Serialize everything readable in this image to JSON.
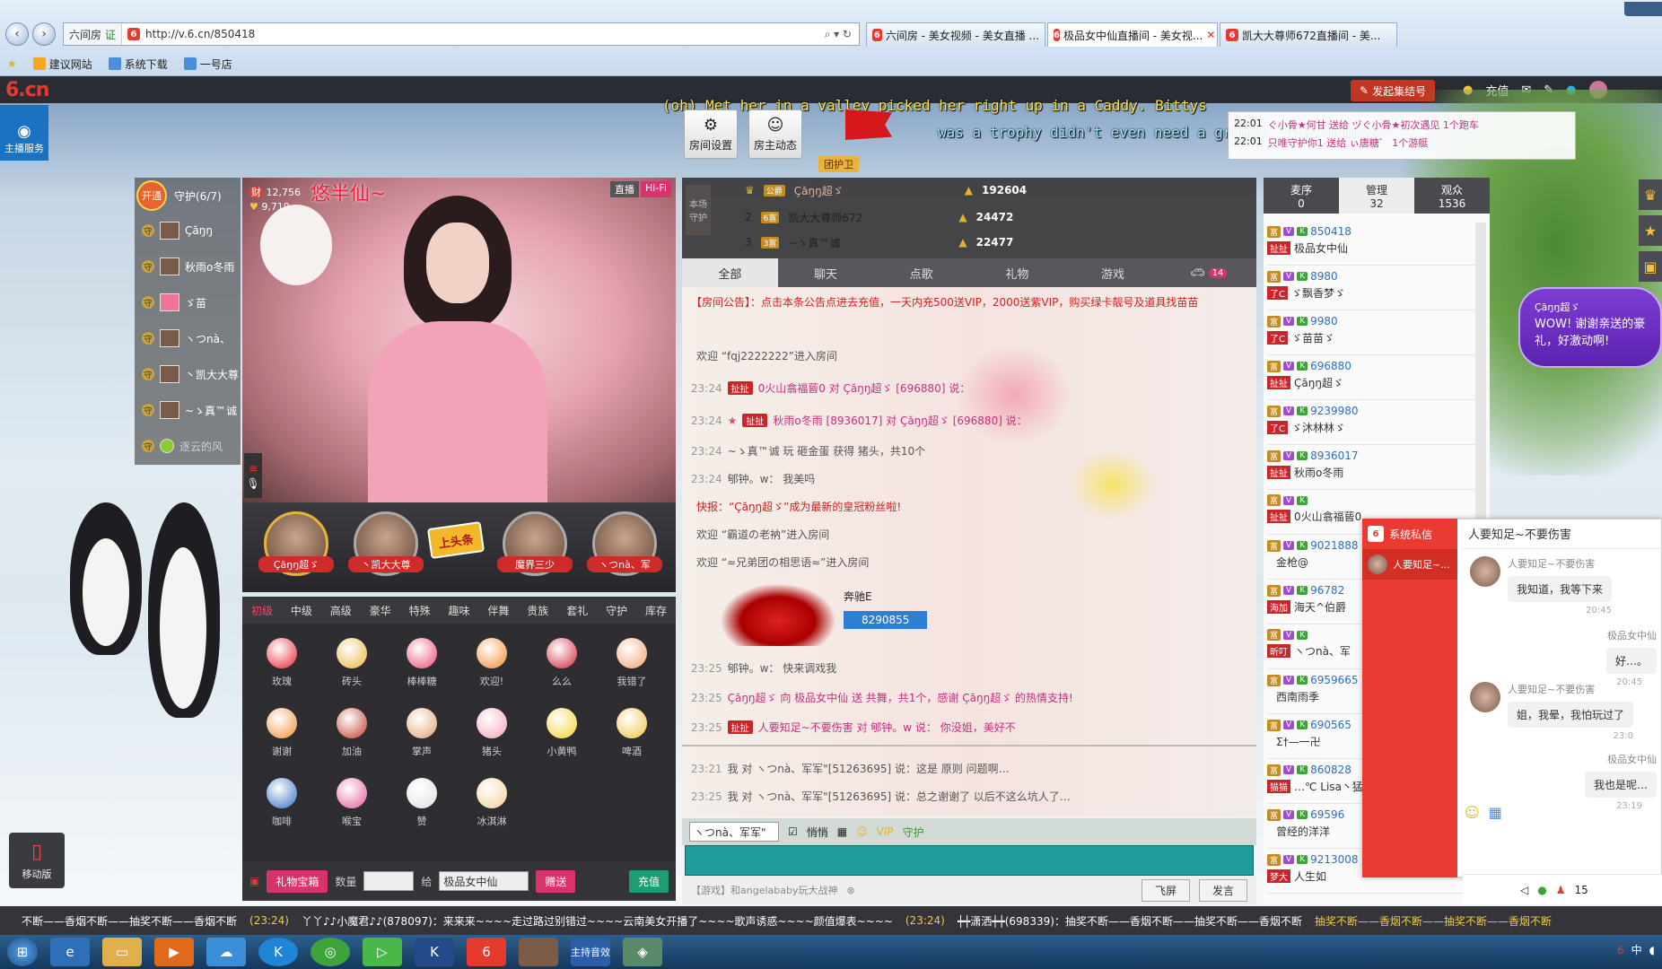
{
  "browser": {
    "site_tag": "六间房",
    "url": "http://v.6.cn/850418",
    "tabs": [
      "六间房 - 美女视频 - 美女直播 ...",
      "极品女中仙直播间 - 美女视...",
      "凯大大尊师672直播间 - 美..."
    ],
    "favorites": [
      "建议网站",
      "系统下载",
      "一号店"
    ]
  },
  "site": {
    "logo": "6.cn",
    "jihao_button": "发起集结号",
    "topnav": [
      "充值"
    ],
    "kefu": "主播服务",
    "mobile": "移动版"
  },
  "lyrics": {
    "line1": "(oh) Met her in a valley picked her right up in a Caddy. Bittys",
    "line2": "was a trophy didn't even need a grammy. This mommys"
  },
  "room": {
    "settings_button": "房间设置",
    "dynamics_button": "房主动态",
    "tuanhu": "团护卫",
    "notifications": [
      {
        "time": "22:01",
        "text": "ぐ小骨★何甘 送给 ヅぐ小骨★初次遇见 1个跑车"
      },
      {
        "time": "22:01",
        "text": "只唯守护你1 送给 ぃ唐糖゛ 1个游艇"
      }
    ]
  },
  "guard": {
    "open_label": "开通",
    "title": "守护(6/7)",
    "members": [
      "Çăŋŋ",
      "秋雨o冬雨",
      "ゞ苗",
      "ヽつnà、",
      "丶凯大大尊",
      "~ゝ真™诚",
      "逐云的风"
    ]
  },
  "video": {
    "name": "悠半仙~",
    "stat1": "12,756",
    "stat2": "9,719",
    "live_label": "直播",
    "hifi_label": "Hi-Fi"
  },
  "rank_strip": {
    "labels": [
      "Çăŋŋ超ゞ",
      "丶凯大大尊",
      "魔界三少",
      "ヽつnà、军"
    ],
    "headline": "上头条"
  },
  "gifts": {
    "tabs": [
      "初级",
      "中级",
      "高级",
      "豪华",
      "特殊",
      "趣味",
      "伴舞",
      "贵族",
      "套礼",
      "守护",
      "库存"
    ],
    "items": [
      {
        "name": "玫瑰",
        "color": "#e2232e"
      },
      {
        "name": "砖头",
        "color": "#e8b33a"
      },
      {
        "name": "棒棒糖",
        "color": "#e84a6c"
      },
      {
        "name": "欢迎!",
        "color": "#f28a28"
      },
      {
        "name": "么么",
        "color": "#d02038"
      },
      {
        "name": "我错了",
        "color": "#f0a06a"
      },
      {
        "name": "谢谢",
        "color": "#f38e3a"
      },
      {
        "name": "加油",
        "color": "#c03a2a"
      },
      {
        "name": "掌声",
        "color": "#e5a070"
      },
      {
        "name": "猪头",
        "color": "#f3a0b8"
      },
      {
        "name": "小黄鸭",
        "color": "#f6d12a"
      },
      {
        "name": "啤酒",
        "color": "#f0c040"
      },
      {
        "name": "咖啡",
        "color": "#2d6fc0"
      },
      {
        "name": "喉宝",
        "color": "#e25a9a"
      },
      {
        "name": "赞",
        "color": "#e0e0e0"
      },
      {
        "name": "冰淇淋",
        "color": "#f0d090"
      }
    ],
    "box_label": "礼物宝箱",
    "qty_label": "数量",
    "to_label": "给",
    "to_value": "极品女中仙",
    "send_label": "赠送",
    "recharge_label": "充值"
  },
  "ranking": {
    "label": "本场守护",
    "rows": [
      {
        "rank": "",
        "name": "Çăŋŋ超ゞ",
        "score": "192604"
      },
      {
        "rank": "2",
        "name": "凯大大尊师672",
        "score": "24472"
      },
      {
        "rank": "3",
        "name": "~ゝ真™诚",
        "score": "22477"
      }
    ]
  },
  "chat": {
    "tabs": [
      "全部",
      "聊天",
      "点歌",
      "礼物",
      "游戏"
    ],
    "car_count": "14",
    "announcement": "【房间公告】：点击本条公告点进去充值，一天内充500送VIP，2000送紫VIP，购买绿卡靓号及道具找苗苗",
    "lines": [
      {
        "time": "",
        "text": "欢迎 “fqj2222222”进入房间"
      },
      {
        "time": "23:24",
        "text": "0火山翕福蒈0 对 Çăŋŋ超ゞ [696880] 说："
      },
      {
        "time": "23:24",
        "text": "秋雨o冬雨 [8936017] 对 Çăŋŋ超ゞ [696880] 说："
      },
      {
        "time": "23:24",
        "text": "~ゝ真™诚 玩 砸金蛋 获得 猪头，共10个"
      },
      {
        "time": "23:24",
        "text": "郇钟。w： 我美吗"
      },
      {
        "time": "",
        "text": "快报：“Çăŋŋ超ゞ”成为最新的皇冠粉丝啦!"
      },
      {
        "time": "",
        "text": "欢迎 “霸道の老衲”进入房间"
      },
      {
        "time": "",
        "text": "欢迎 “≈兄弟团の相思语≈”进入房间"
      }
    ],
    "car_name": "奔驰E",
    "car_id": "8290855",
    "lines2": [
      {
        "time": "23:25",
        "text": "郇钟。w： 快来调戏我"
      },
      {
        "time": "23:25",
        "text": "Çăŋŋ超ゞ 向 极品女中仙 送 共舞，共1个，感谢 Çăŋŋ超ゞ 的热情支持!"
      },
      {
        "time": "23:25",
        "text": "人要知足~不要伤害 对 郇钟。w 说： 你没姐，美好不"
      }
    ],
    "private": [
      {
        "time": "23:21",
        "text": "我 对 ヽつnà、军军\"[51263695] 说：这是 原则 问题啊…"
      },
      {
        "time": "23:25",
        "text": "我 对 ヽつnà、军军\"[51263695] 说：总之谢谢了 以后不这么坑人了…"
      }
    ],
    "input_target": "ヽつnà、军军\"",
    "whisper_label": "悄悄",
    "game_hint": "【游戏】和angelababy玩大战神",
    "fly_button": "飞屏",
    "send_button": "发言"
  },
  "users": {
    "tabs": [
      {
        "label": "麦序",
        "count": "0"
      },
      {
        "label": "管理",
        "count": "32"
      },
      {
        "label": "观众",
        "count": "1536"
      }
    ],
    "entries": [
      {
        "id": "850418",
        "name": "极品女中仙",
        "tag": "扯扯"
      },
      {
        "id": "8980",
        "name": "ゞ飘香梦ゞ",
        "tag": "了C"
      },
      {
        "id": "9980",
        "name": "ゞ苗苗ゞ",
        "tag": "了C"
      },
      {
        "id": "696880",
        "name": "Çăŋŋ超ゞ",
        "tag": "扯扯"
      },
      {
        "id": "9239980",
        "name": "ゞ沐林林ゞ",
        "tag": "了C"
      },
      {
        "id": "8936017",
        "name": "秋雨o冬雨",
        "tag": "扯扯"
      },
      {
        "id": "",
        "name": "0火山翕福蒈0",
        "tag": "扯扯"
      },
      {
        "id": "9021888",
        "name": "金枪@",
        "tag": ""
      },
      {
        "id": "96782",
        "name": "海天^伯爵",
        "tag": "海加"
      },
      {
        "id": "",
        "name": "ヽつnà、军",
        "tag": "昕叮"
      },
      {
        "id": "6959665",
        "name": "西南雨季",
        "tag": ""
      },
      {
        "id": "690565",
        "name": "Σ†—一卍",
        "tag": ""
      },
      {
        "id": "860828",
        "name": "…℃ Lisa丶猛",
        "tag": "猫猫"
      },
      {
        "id": "69596",
        "name": "曾经的洋洋",
        "tag": ""
      },
      {
        "id": "9213008",
        "name": "人生如",
        "tag": "梦大"
      }
    ]
  },
  "pm": {
    "side_title": "系统私信",
    "contact": "人要知足~...",
    "header": "人要知足~不要伤害",
    "messages": [
      {
        "from": "人要知足~不要伤害",
        "text": "我知道，我等下来",
        "time": "20:45",
        "self": false
      },
      {
        "from": "极品女中仙",
        "text": "好…。",
        "time": "20:45",
        "self": true
      },
      {
        "from": "人要知足~不要伤害",
        "text": "姐，我晕，我怕玩过了",
        "time": "23:0",
        "self": false
      },
      {
        "from": "极品女中仙",
        "text": "我也是呢…",
        "time": "23:19",
        "self": true
      }
    ],
    "online_count": "15"
  },
  "speech": {
    "name": "Çăŋŋ超ゞ",
    "text": "WOW! 谢谢亲送的豪礼，好激动啊!"
  },
  "ticker": {
    "items": [
      "不断——香烟不断——抽奖不断——香烟不断",
      "(23:24)",
      "丫丫♪♪小魔君♪♪(878097)：来来来~~~~走过路过别错过~~~~云南美女开播了~~~~歌声诱惑~~~~颜值爆表~~~~",
      "(23:24)",
      "┿┿潇洒┿┿(698339)：抽奖不断——香烟不断——抽奖不断——香烟不断",
      "抽奖不断——香烟不断——抽奖不断——香烟不断"
    ]
  },
  "taskbar": {
    "apps": [
      "start-orb",
      "ie",
      "explorer",
      "media",
      "cloud",
      "k",
      "360",
      "player",
      "k2",
      "6cn",
      "avatar",
      "zhubo",
      "shield"
    ],
    "zhubo_label": "主持音效",
    "ime": "中"
  }
}
